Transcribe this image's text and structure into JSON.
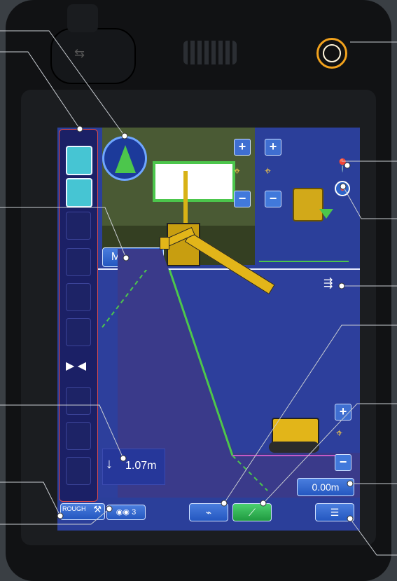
{
  "screen": {
    "min_dist_label": "Min Dist.",
    "depth_value": "1.07m",
    "offset_value": "0.00m",
    "rough_label": "ROUGH",
    "layer_count": "3"
  },
  "colors": {
    "screen_bg": "#2b3f9a",
    "design_surface": "#4cc64c",
    "active_slot": "#46c5d3",
    "sidebar_border": "#e04a4a"
  },
  "icons": {
    "usb": "usb-icon",
    "camera": "camera-icon",
    "compass": "compass-icon",
    "map_pin": "map-pin-icon",
    "target": "target-icon",
    "guidance": "guidance-icon",
    "menu": "menu-icon"
  }
}
